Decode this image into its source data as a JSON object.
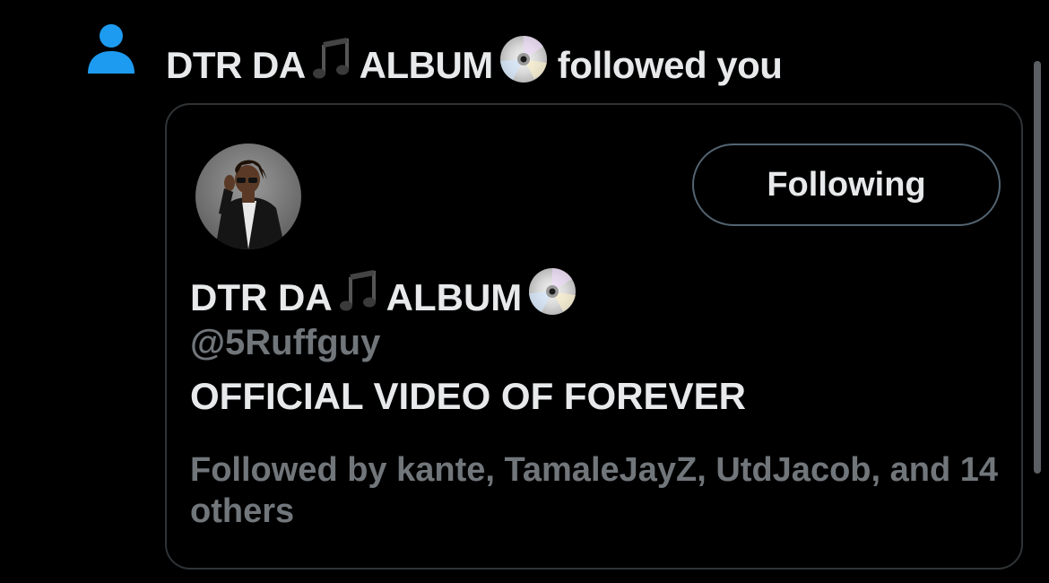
{
  "notification": {
    "actor_name_part1": "DTR DA",
    "actor_name_part2": "ALBUM",
    "action_text": "followed you",
    "icon": "person-icon",
    "icon_color": "#1d9bf0"
  },
  "user_card": {
    "display_name_part1": "DTR DA",
    "display_name_part2": "ALBUM",
    "handle": "@5Ruffguy",
    "bio": "OFFICIAL VIDEO OF FOREVER",
    "followed_by": "Followed by kante, TamaleJayZ, UtdJacob, and 14 others",
    "follow_button_label": "Following"
  },
  "emojis": {
    "music": "musical-note-icon",
    "disc": "optical-disc-icon"
  },
  "colors": {
    "background": "#000000",
    "text_primary": "#e7e9ea",
    "text_secondary": "#71767b",
    "accent": "#1d9bf0",
    "border": "#2f3336"
  }
}
